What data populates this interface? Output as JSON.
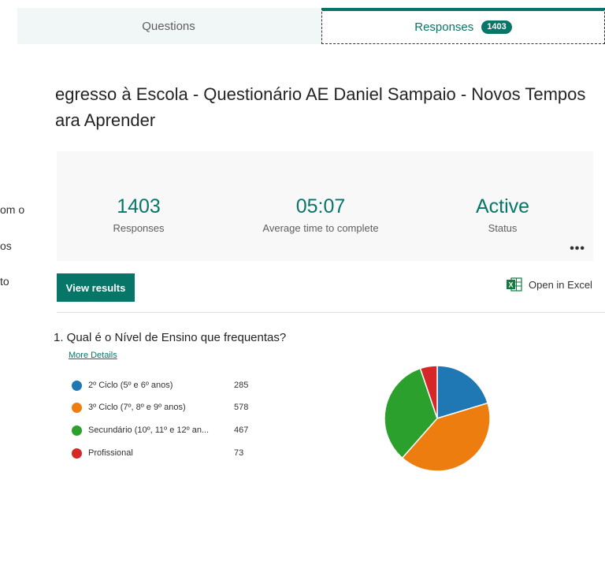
{
  "tabs": {
    "questions_label": "Questions",
    "responses_label": "Responses",
    "responses_badge": "1403",
    "active": "responses"
  },
  "form": {
    "title_line1": "egresso à Escola - Questionário AE Daniel Sampaio - Novos Tempos",
    "title_line2": "ara Aprender"
  },
  "left_fragments": [
    "om o",
    "os",
    "to"
  ],
  "stats": {
    "responses_value": "1403",
    "responses_label": "Responses",
    "avg_time_value": "05:07",
    "avg_time_label": "Average time to complete",
    "status_value": "Active",
    "status_label": "Status",
    "more_icon": "ellipsis-icon"
  },
  "actions": {
    "view_results_label": "View results",
    "open_excel_label": "Open in Excel",
    "excel_icon": "excel-icon"
  },
  "question": {
    "title": "1. Qual é o Nível de Ensino que frequentas?",
    "more_details": "More Details"
  },
  "chart_data": {
    "type": "pie",
    "categories": [
      "2º Ciclo (5º e 6º anos)",
      "3º Ciclo (7º, 8º e 9º anos)",
      "Secundário (10º, 11º e 12º an...",
      "Profissional"
    ],
    "values": [
      285,
      578,
      467,
      73
    ],
    "colors": [
      "#1f77b4",
      "#ed7d0e",
      "#2ca02c",
      "#d62728"
    ],
    "legend_position": "left"
  }
}
